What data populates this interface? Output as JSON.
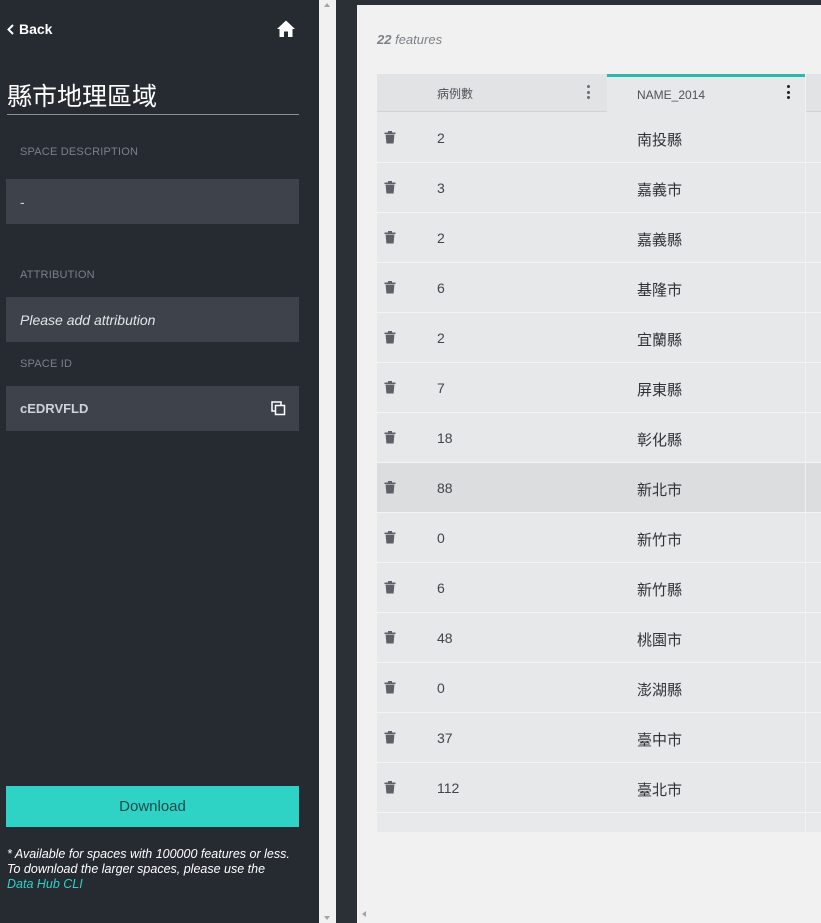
{
  "sidebar": {
    "back_label": "Back",
    "title": "縣市地理區域",
    "description_label": "SPACE DESCRIPTION",
    "description_value": "-",
    "attribution_label": "ATTRIBUTION",
    "attribution_placeholder": "Please add attribution",
    "space_id_label": "SPACE ID",
    "space_id_value": "cEDRVFLD",
    "download_label": "Download",
    "note_line1": "* Available for spaces with 100000 features or less.",
    "note_line2": "To download the larger spaces, please use the",
    "note_link": "Data Hub CLI"
  },
  "main": {
    "feature_count": "22",
    "feature_suffix": "features",
    "columns": [
      "病例數",
      "NAME_2014"
    ],
    "rows": [
      {
        "count": "2",
        "name": "南投縣"
      },
      {
        "count": "3",
        "name": "嘉義市"
      },
      {
        "count": "2",
        "name": "嘉義縣"
      },
      {
        "count": "6",
        "name": "基隆市"
      },
      {
        "count": "2",
        "name": "宜蘭縣"
      },
      {
        "count": "7",
        "name": "屏東縣"
      },
      {
        "count": "18",
        "name": "彰化縣"
      },
      {
        "count": "88",
        "name": "新北市"
      },
      {
        "count": "0",
        "name": "新竹市"
      },
      {
        "count": "6",
        "name": "新竹縣"
      },
      {
        "count": "48",
        "name": "桃園市"
      },
      {
        "count": "0",
        "name": "澎湖縣"
      },
      {
        "count": "37",
        "name": "臺中市"
      },
      {
        "count": "112",
        "name": "臺北市"
      }
    ],
    "highlighted_row": 7
  },
  "colors": {
    "accent": "#2ed3c6",
    "sidebar_bg": "#262a31",
    "field_bg": "#3e434b"
  },
  "icons": [
    "chevron-left-icon",
    "home-icon",
    "copy-icon",
    "trash-icon",
    "kebab-menu-icon"
  ]
}
